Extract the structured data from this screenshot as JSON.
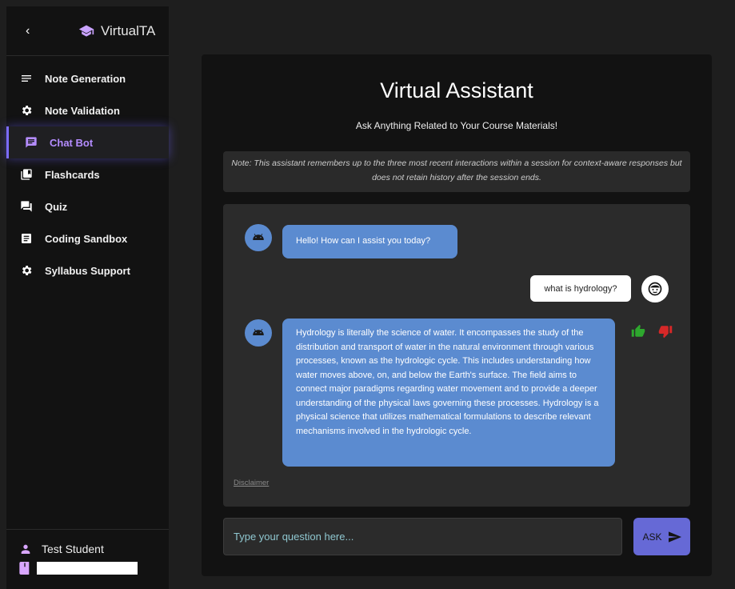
{
  "sidebar": {
    "brand": "VirtualTA",
    "items": [
      {
        "label": "Note Generation"
      },
      {
        "label": "Note Validation"
      },
      {
        "label": "Chat Bot"
      },
      {
        "label": "Flashcards"
      },
      {
        "label": "Quiz"
      },
      {
        "label": "Coding Sandbox"
      },
      {
        "label": "Syllabus Support"
      }
    ],
    "user_name": "Test Student"
  },
  "main": {
    "title": "Virtual Assistant",
    "subtitle": "Ask Anything Related to Your Course Materials!",
    "note": "Note: This assistant remembers up to the three most recent interactions within a session for context-aware responses but does not retain history after the session ends.",
    "messages": [
      {
        "from": "bot",
        "text": "Hello! How can I assist you today?"
      },
      {
        "from": "user",
        "text": "what is hydrology?"
      },
      {
        "from": "bot",
        "text": "Hydrology is literally the science of water. It encompasses the study of the distribution and transport of water in the natural environment through various processes, known as the hydrologic cycle. This includes understanding how water moves above, on, and below the Earth's surface. The field aims to connect major paradigms regarding water movement and to provide a deeper understanding of the physical laws governing these processes. Hydrology is a physical science that utilizes mathematical formulations to describe relevant mechanisms involved in the hydrologic cycle."
      }
    ],
    "disclaimer": "Disclaimer",
    "input_placeholder": "Type your question here...",
    "ask_label": "ASK"
  },
  "colors": {
    "accent": "#b48cff",
    "bot_bubble": "#5b8bd0",
    "ask_button": "#6669d6",
    "thumb_up": "#2ea82e",
    "thumb_down": "#d62828"
  }
}
